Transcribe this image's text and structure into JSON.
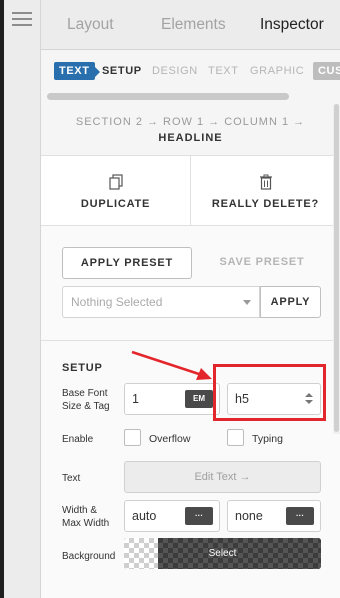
{
  "tabs": {
    "layout": "Layout",
    "elements": "Elements",
    "inspector": "Inspector"
  },
  "subtabs": {
    "text_pill": "TEXT",
    "setup": "SETUP",
    "design": "DESIGN",
    "text": "TEXT",
    "graphic": "GRAPHIC",
    "custom": "CUST"
  },
  "breadcrumb": {
    "path": "SECTION 2 → ROW 1 → COLUMN 1 →",
    "current": "HEADLINE"
  },
  "actions": {
    "duplicate": "DUPLICATE",
    "delete": "REALLY DELETE?"
  },
  "preset": {
    "apply_preset": "APPLY PRESET",
    "save_preset": "SAVE PRESET",
    "select_placeholder": "Nothing Selected",
    "apply": "APPLY"
  },
  "setup": {
    "title": "SETUP",
    "base_font_label_1": "Base Font",
    "base_font_label_2": "Size & Tag",
    "font_size_value": "1",
    "font_unit": "EM",
    "tag_value": "h5",
    "enable_label": "Enable",
    "overflow_label": "Overflow",
    "typing_label": "Typing",
    "text_label": "Text",
    "edit_text": "Edit Text →",
    "width_label_1": "Width &",
    "width_label_2": "Max Width",
    "width_value": "auto",
    "max_width_value": "none",
    "more_glyph": "···",
    "background_label": "Background",
    "background_select": "Select"
  },
  "colors": {
    "accent_blue": "#2a6fad",
    "highlight_red": "#e3262b"
  }
}
